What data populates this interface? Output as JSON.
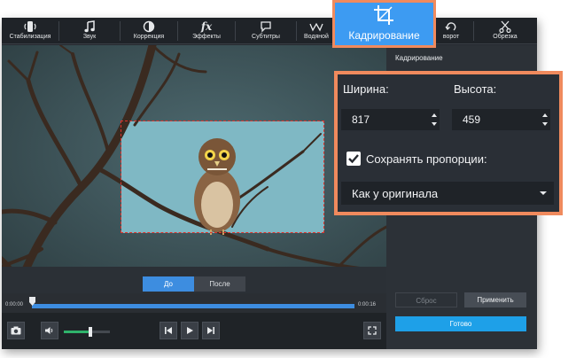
{
  "toolbar": {
    "tools": [
      {
        "label": "Стабилизация",
        "icon": "stabilization-icon"
      },
      {
        "label": "Звук",
        "icon": "music-note-icon"
      },
      {
        "label": "Коррекция",
        "icon": "color-correction-icon"
      },
      {
        "label": "Эффекты",
        "icon": "fx-icon"
      },
      {
        "label": "Субтитры",
        "icon": "speech-bubble-icon"
      },
      {
        "label": "Водяной",
        "icon": "watermark-icon"
      },
      {
        "label": "ворот",
        "icon": "rotate-icon"
      },
      {
        "label": "Обрезка",
        "icon": "scissors-icon"
      }
    ],
    "active_tab": {
      "label": "Кадрирование",
      "icon": "crop-icon"
    }
  },
  "preview": {
    "before_label": "До",
    "after_label": "После",
    "time_start": "0:00:00",
    "time_end": "0:00:16"
  },
  "panel": {
    "title": "Кадрирование",
    "reset_label": "Сброс",
    "apply_label": "Применить",
    "done_label": "Готово"
  },
  "crop_settings": {
    "width_label": "Ширина:",
    "width_value": "817",
    "height_label": "Высота:",
    "height_value": "459",
    "keep_ratio_label": "Сохранять пропорции:",
    "keep_ratio_checked": true,
    "aspect_value": "Как у оригинала"
  },
  "colors": {
    "accent": "#3d9bf2",
    "highlight_border": "#f08a5d",
    "crop_frame": "#e0332c",
    "volume": "#2fb36b"
  }
}
